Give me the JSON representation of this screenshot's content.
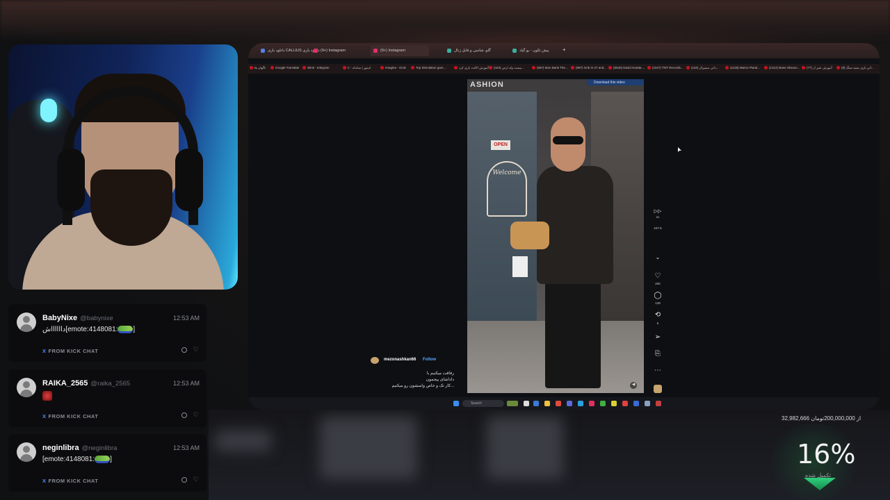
{
  "browser": {
    "tabs": [
      {
        "label": "دانلود بازی CALLIUS دانلود بازی",
        "active": false
      },
      {
        "label": "(9+) Instagram",
        "active": false
      },
      {
        "label": "(9+) Instagram",
        "active": true
      },
      {
        "label": "گاو، شاسی و فایل ژنال",
        "active": false
      },
      {
        "label": "پیش تکون - یو گپاد",
        "active": false
      }
    ],
    "new_tab_symbol": "+",
    "bookmarks": [
      "ناگهان ها",
      "Google Translate",
      "Wink - telegram",
      "ادیتور | سامانه - تا",
      "Imagine - Grok",
      "Top Simulation gam...",
      "آموزش اکانت بازی کرد",
      "(444) بیست ولد ارض...",
      "(587) Mon Bank The...",
      "(987) Gnb In 27 and...",
      "(5040) David Guetta ...",
      "(1047) TNT Records...",
      "(119) دانی مسیرال...",
      "(1128) Mamo Plural...",
      "(1312) Bass Vibrace...",
      "(77) آموزش عنبر از",
      "(8) اتن بازی بسیه سنگ..."
    ],
    "download_label": "Download this video",
    "video": {
      "shop_name": "ASHION",
      "open_sign": "OPEN",
      "welcome_sign": "Welcome",
      "poster": "mezonashkan66",
      "follow_label": "Follow",
      "caption_lines": [
        "رفاقت میکنیم با",
        "داداشای پیجمون",
        "کار تک و خاص واسشون رو میکنیم..."
      ]
    },
    "rail": {
      "speed": "1x",
      "wpm": "247.8",
      "likes": "200",
      "comments": "139",
      "reposts": "5"
    },
    "taskbar_search": "Search"
  },
  "chat": [
    {
      "username": "BabyNixe",
      "handle": "@babynixe",
      "time": "12:53 AM",
      "message": "دااااااش[emote:4148081:",
      "message_end": "]",
      "source": "FROM KICK CHAT"
    },
    {
      "username": "RAIKA_2565",
      "handle": "@raika_2565",
      "time": "12:53 AM",
      "message": "",
      "message_end": "",
      "source": "FROM KICK CHAT"
    },
    {
      "username": "neginlibra",
      "handle": "@neginlibra",
      "time": "12:53 AM",
      "message": "[emote:4148081:",
      "message_end": "]",
      "source": "FROM KICK CHAT"
    }
  ],
  "donation": {
    "text": "32,982,666 از 200,000,000تومان",
    "percent": "16%",
    "label": "تکمیل شده",
    "progress": 0.16
  },
  "colors": {
    "accent_green": "#2fcf7c",
    "link_blue": "#5aa8ff",
    "kick_x_blue": "#4c8cff"
  }
}
